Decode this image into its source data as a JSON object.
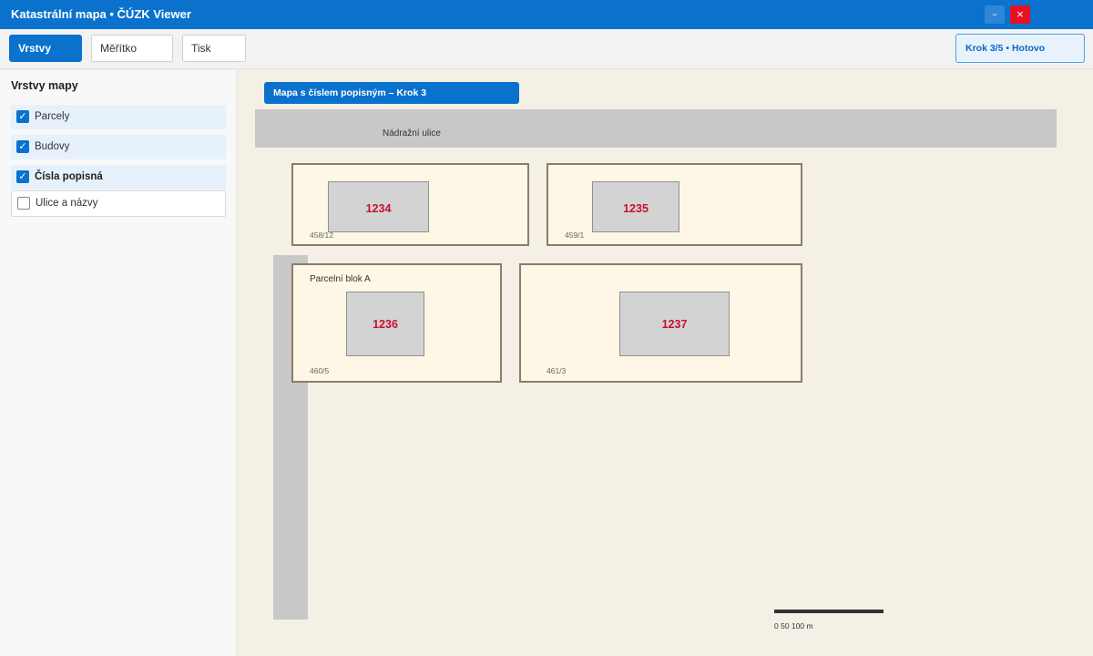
{
  "window": {
    "title": "Katastrální mapa • ČÚZK Viewer",
    "minimize_glyph": "–",
    "close_glyph": "×"
  },
  "toolbar": {
    "buttons": [
      {
        "label": "Vrstvy",
        "active": true
      },
      {
        "label": "Měřítko",
        "active": false
      },
      {
        "label": "Tisk",
        "active": false
      }
    ],
    "step_status": "Krok 3/5 • Hotovo"
  },
  "sidebar": {
    "title": "Vrstvy mapy",
    "layers": [
      {
        "label": "Parcely",
        "checked": true
      },
      {
        "label": "Budovy",
        "checked": true
      },
      {
        "label": "Čísla popisná",
        "checked": true
      },
      {
        "label": "Ulice a názvy",
        "checked": false
      }
    ],
    "check_glyph": "✓"
  },
  "map": {
    "banner": "Mapa s číslem popisným – Krok 3",
    "street_name": "Nádražní ulice",
    "parcels": [
      {
        "parcel_number": "458/12",
        "house_number": "1234"
      },
      {
        "parcel_number": "459/1",
        "house_number": "1235"
      },
      {
        "parcel_number": "460/5",
        "house_number": "1236",
        "block_label": "Parcelní blok A"
      },
      {
        "parcel_number": "461/3",
        "house_number": "1237"
      }
    ],
    "scale_label": "0 50 100 m"
  },
  "colors": {
    "accent": "#0a72cd",
    "close": "#e81123",
    "house_number": "#c8102e",
    "parcel_fill": "#fef7e6",
    "parcel_border": "#8b7d6b",
    "building_fill": "#d3d3d3",
    "street": "#c8c8c8",
    "map_background": "#f4f0e6"
  }
}
